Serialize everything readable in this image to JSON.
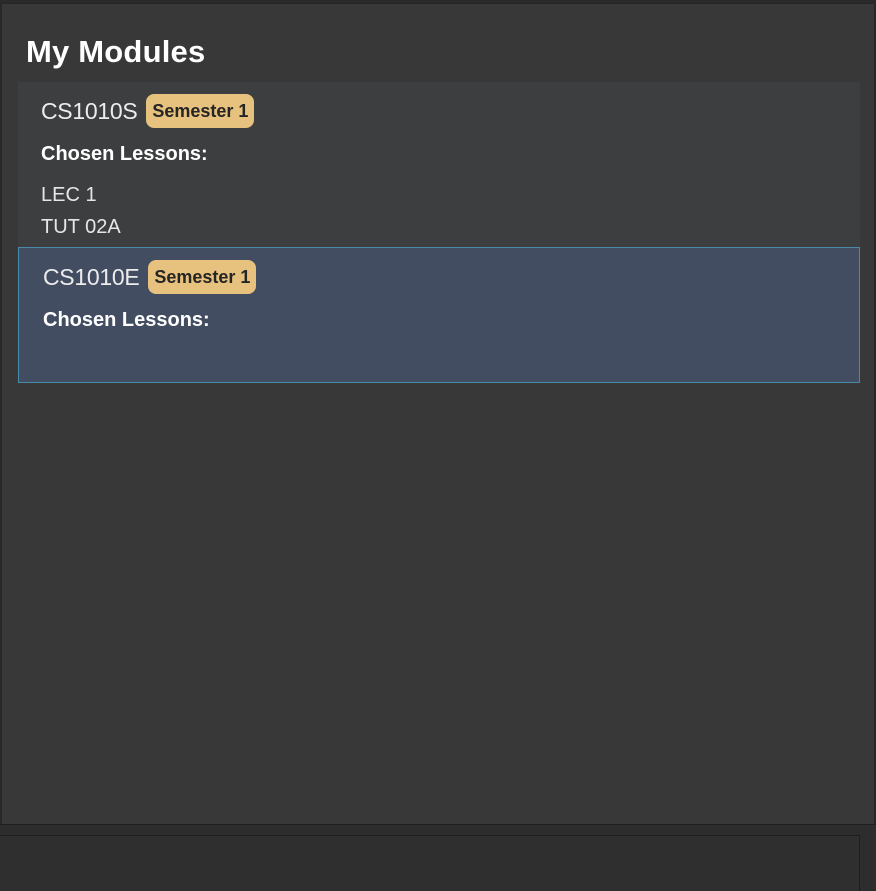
{
  "panel": {
    "title": "My Modules"
  },
  "modules": [
    {
      "code": "CS1010S",
      "semester": "Semester 1",
      "lessons_heading": "Chosen Lessons:",
      "lessons": [
        "LEC 1",
        "TUT 02A"
      ]
    },
    {
      "code": "CS1010E",
      "semester": "Semester 1",
      "lessons_heading": "Chosen Lessons:",
      "lessons": []
    }
  ],
  "colors": {
    "badge": "#e7c27e",
    "selected_card": "#424d61",
    "selected_border": "#4b8aa8"
  }
}
